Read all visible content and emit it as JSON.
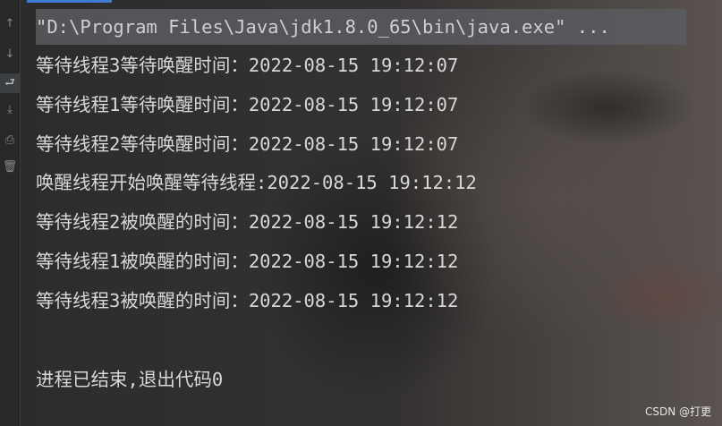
{
  "gutter": {
    "icons": [
      "arrow-up-icon",
      "arrow-down-icon",
      "soft-wrap-icon",
      "scroll-to-end-icon",
      "print-icon",
      "trash-icon"
    ]
  },
  "console": {
    "command": "\"D:\\Program Files\\Java\\jdk1.8.0_65\\bin\\java.exe\" ...",
    "lines": [
      "等待线程3等待唤醒时间：2022-08-15 19:12:07",
      "等待线程1等待唤醒时间：2022-08-15 19:12:07",
      "等待线程2等待唤醒时间：2022-08-15 19:12:07",
      "唤醒线程开始唤醒等待线程:2022-08-15 19:12:12",
      "等待线程2被唤醒的时间：2022-08-15 19:12:12",
      "等待线程1被唤醒的时间：2022-08-15 19:12:12",
      "等待线程3被唤醒的时间：2022-08-15 19:12:12"
    ],
    "exit_message": "进程已结束,退出代码0"
  },
  "watermark": "CSDN @打更"
}
